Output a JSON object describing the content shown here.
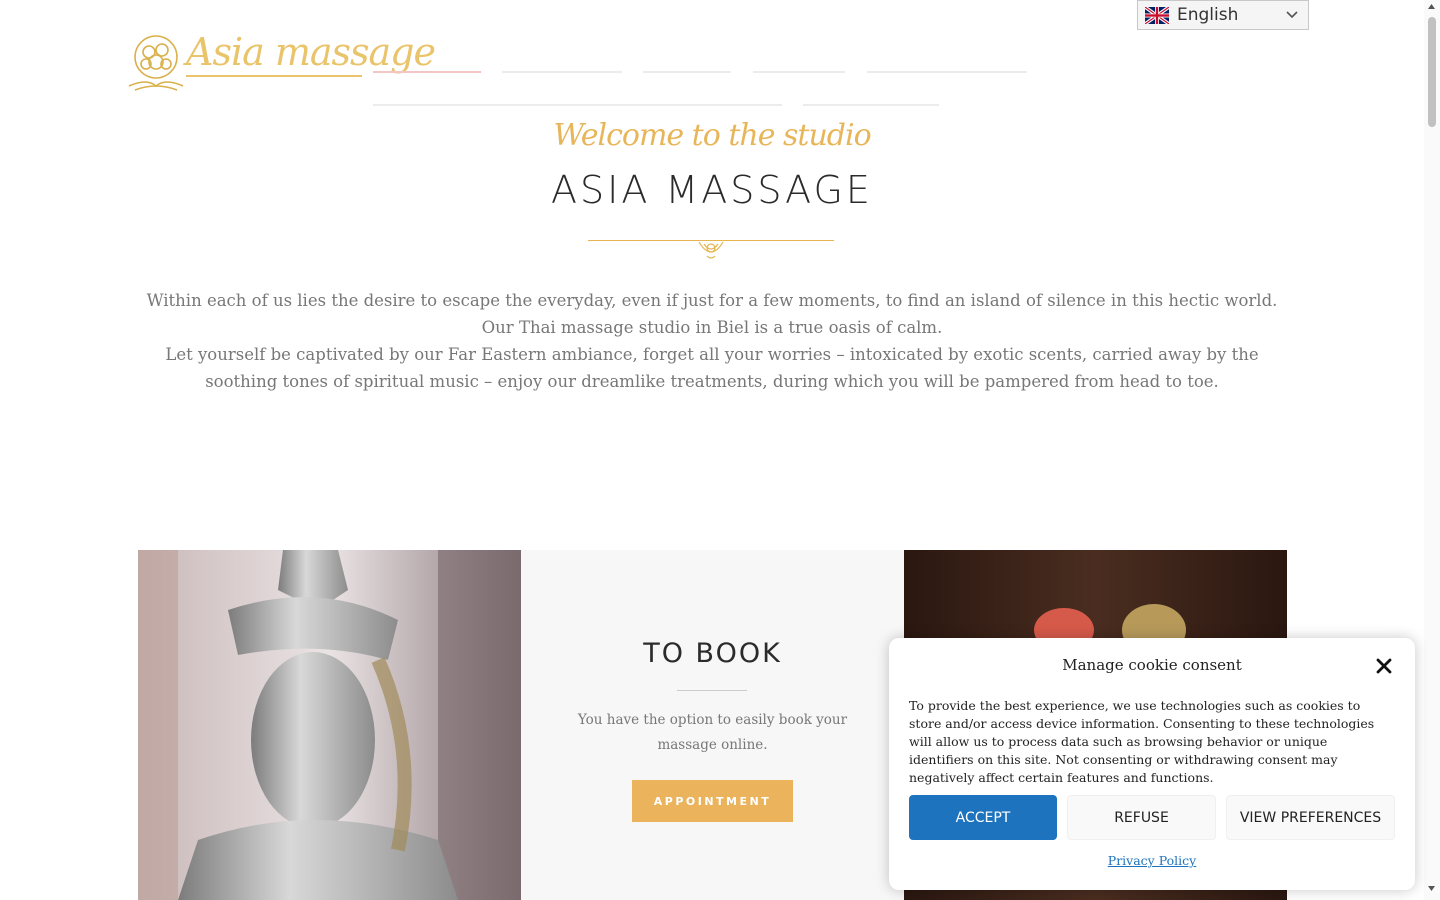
{
  "header": {
    "logo_text": "Asia massage",
    "language_selector": {
      "selected": "English",
      "flag_icon": "uk-flag-icon"
    }
  },
  "intro": {
    "subtitle": "Welcome to the studio",
    "title": "ASIA MASSAGE",
    "paragraph_1": "Within each of us lies the desire to escape the everyday, even if just for a few moments, to find an island of silence in this hectic world. Our Thai massage studio in Biel is a true oasis of calm.",
    "paragraph_2": "Let yourself be captivated by our Far Eastern ambiance, forget all your worries – intoxicated by exotic scents, carried away by the soothing tones of spiritual music – enjoy our dreamlike treatments, during which you will be pampered from head to toe."
  },
  "booking": {
    "title": "TO BOOK",
    "text": "You have the option to easily book your massage online.",
    "button_label": "APPOINTMENT"
  },
  "cookie_consent": {
    "title": "Manage cookie consent",
    "text": "To provide the best experience, we use technologies such as cookies to store and/or access device information. Consenting to these technologies will allow us to process data such as browsing behavior or unique identifiers on this site. Not consenting or withdrawing consent may negatively affect certain features and functions.",
    "accept_label": "ACCEPT",
    "refuse_label": "REFUSE",
    "preferences_label": "VIEW PREFERENCES",
    "privacy_link": "Privacy Policy"
  },
  "colors": {
    "gold": "#eab35c",
    "accept_blue": "#1e73be",
    "nav_active": "#f3c6c6"
  }
}
